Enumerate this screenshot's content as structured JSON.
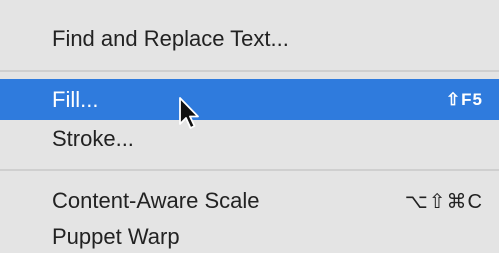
{
  "menu": {
    "items": [
      {
        "label": "Find and Replace Text...",
        "shortcut": ""
      },
      {
        "label": "Fill...",
        "shortcut": "⇧F5"
      },
      {
        "label": "Stroke...",
        "shortcut": ""
      },
      {
        "label": "Content-Aware Scale",
        "shortcut": "⌥⇧⌘C"
      },
      {
        "label": "Puppet Warp",
        "shortcut": ""
      }
    ],
    "highlighted_item": "Fill...",
    "highlight_color": "#2f7bdd",
    "background_color": "#e4e4e4"
  },
  "cursor": {
    "icon": "arrow-pointer-icon"
  }
}
